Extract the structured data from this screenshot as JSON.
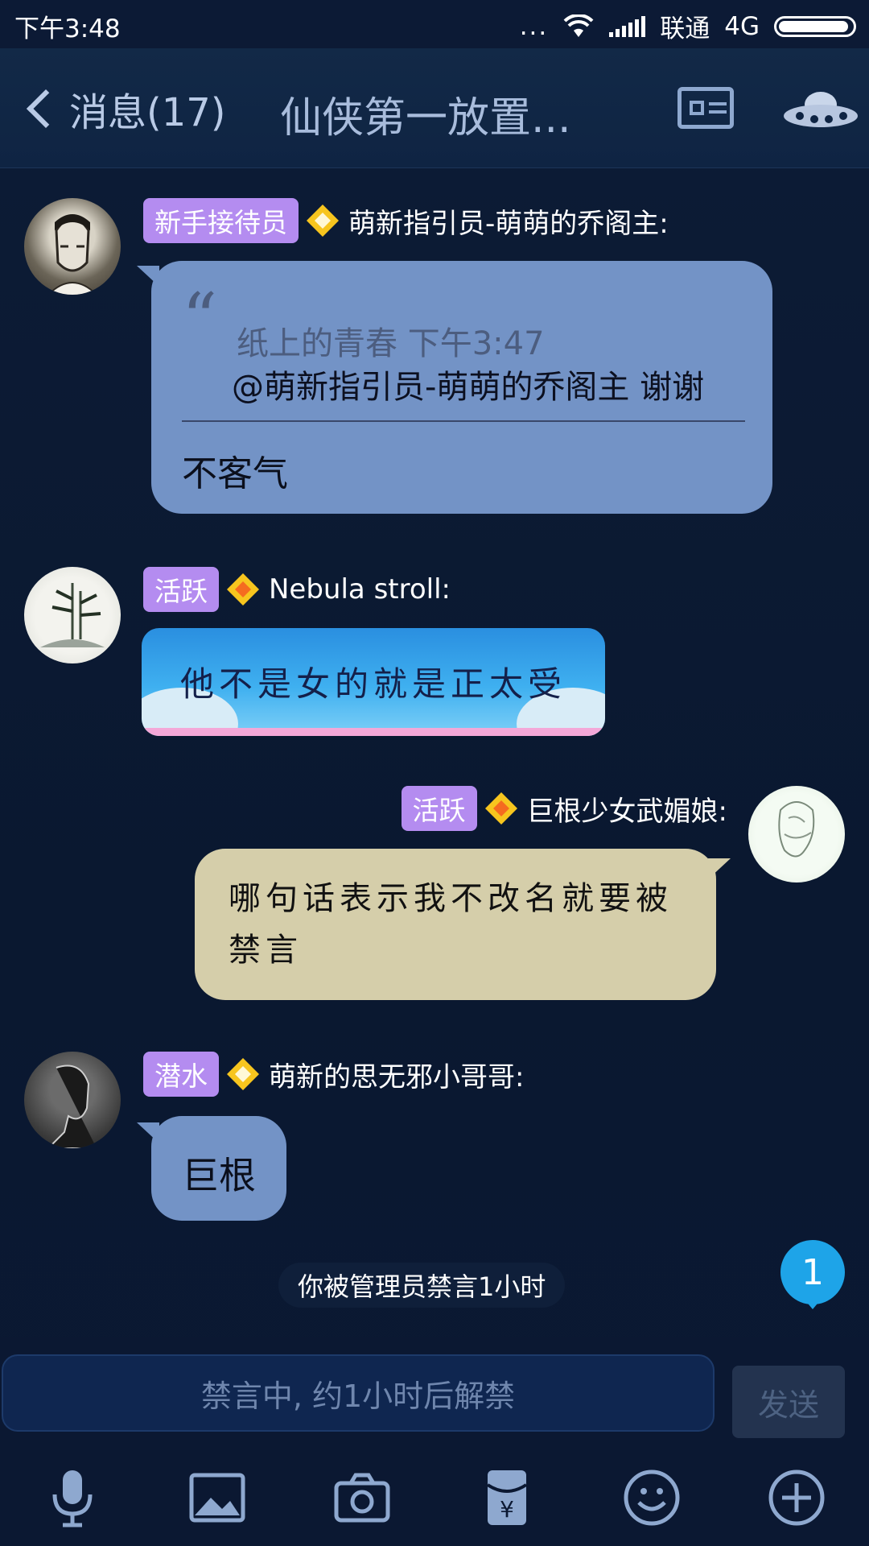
{
  "status_bar": {
    "time": "下午3:48",
    "dots": "...",
    "carrier": "联通",
    "network": "4G"
  },
  "nav": {
    "back_label": "消息(17)",
    "title": "仙侠第一放置..."
  },
  "messages": [
    {
      "badge": "新手接待员",
      "sender": "萌新指引员-萌萌的乔阁主:",
      "quote_author": "纸上的青春 下午3:47",
      "quote_text": "@萌新指引员-萌萌的乔阁主 谢谢",
      "text": "不客气"
    },
    {
      "badge": "活跃",
      "sender": "Nebula stroll:",
      "text": "他不是女的就是正太受"
    },
    {
      "badge": "活跃",
      "sender": "巨根少女武媚娘:",
      "text": "哪句话表示我不改名就要被禁言"
    },
    {
      "badge": "潜水",
      "sender": "萌新的思无邪小哥哥:",
      "text": "巨根"
    }
  ],
  "system_notice": "你被管理员禁言1小时",
  "unread_count": "1",
  "input": {
    "placeholder": "禁言中, 约1小时后解禁",
    "send_label": "发送"
  },
  "colors": {
    "badge": "#b48cf0",
    "bubble_blue": "#7393c6",
    "bubble_khaki": "#d5ceaa",
    "unread": "#1ea4e8"
  },
  "icons": [
    "microphone-icon",
    "image-icon",
    "camera-icon",
    "red-packet-icon",
    "emoji-icon",
    "plus-icon"
  ]
}
